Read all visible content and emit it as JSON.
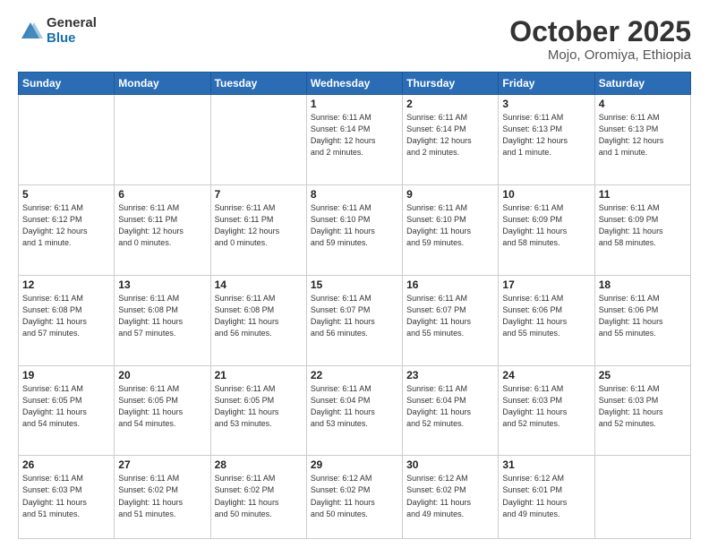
{
  "header": {
    "logo_general": "General",
    "logo_blue": "Blue",
    "title": "October 2025",
    "location": "Mojo, Oromiya, Ethiopia"
  },
  "days_of_week": [
    "Sunday",
    "Monday",
    "Tuesday",
    "Wednesday",
    "Thursday",
    "Friday",
    "Saturday"
  ],
  "weeks": [
    [
      {
        "num": "",
        "info": ""
      },
      {
        "num": "",
        "info": ""
      },
      {
        "num": "",
        "info": ""
      },
      {
        "num": "1",
        "info": "Sunrise: 6:11 AM\nSunset: 6:14 PM\nDaylight: 12 hours\nand 2 minutes."
      },
      {
        "num": "2",
        "info": "Sunrise: 6:11 AM\nSunset: 6:14 PM\nDaylight: 12 hours\nand 2 minutes."
      },
      {
        "num": "3",
        "info": "Sunrise: 6:11 AM\nSunset: 6:13 PM\nDaylight: 12 hours\nand 1 minute."
      },
      {
        "num": "4",
        "info": "Sunrise: 6:11 AM\nSunset: 6:13 PM\nDaylight: 12 hours\nand 1 minute."
      }
    ],
    [
      {
        "num": "5",
        "info": "Sunrise: 6:11 AM\nSunset: 6:12 PM\nDaylight: 12 hours\nand 1 minute."
      },
      {
        "num": "6",
        "info": "Sunrise: 6:11 AM\nSunset: 6:11 PM\nDaylight: 12 hours\nand 0 minutes."
      },
      {
        "num": "7",
        "info": "Sunrise: 6:11 AM\nSunset: 6:11 PM\nDaylight: 12 hours\nand 0 minutes."
      },
      {
        "num": "8",
        "info": "Sunrise: 6:11 AM\nSunset: 6:10 PM\nDaylight: 11 hours\nand 59 minutes."
      },
      {
        "num": "9",
        "info": "Sunrise: 6:11 AM\nSunset: 6:10 PM\nDaylight: 11 hours\nand 59 minutes."
      },
      {
        "num": "10",
        "info": "Sunrise: 6:11 AM\nSunset: 6:09 PM\nDaylight: 11 hours\nand 58 minutes."
      },
      {
        "num": "11",
        "info": "Sunrise: 6:11 AM\nSunset: 6:09 PM\nDaylight: 11 hours\nand 58 minutes."
      }
    ],
    [
      {
        "num": "12",
        "info": "Sunrise: 6:11 AM\nSunset: 6:08 PM\nDaylight: 11 hours\nand 57 minutes."
      },
      {
        "num": "13",
        "info": "Sunrise: 6:11 AM\nSunset: 6:08 PM\nDaylight: 11 hours\nand 57 minutes."
      },
      {
        "num": "14",
        "info": "Sunrise: 6:11 AM\nSunset: 6:08 PM\nDaylight: 11 hours\nand 56 minutes."
      },
      {
        "num": "15",
        "info": "Sunrise: 6:11 AM\nSunset: 6:07 PM\nDaylight: 11 hours\nand 56 minutes."
      },
      {
        "num": "16",
        "info": "Sunrise: 6:11 AM\nSunset: 6:07 PM\nDaylight: 11 hours\nand 55 minutes."
      },
      {
        "num": "17",
        "info": "Sunrise: 6:11 AM\nSunset: 6:06 PM\nDaylight: 11 hours\nand 55 minutes."
      },
      {
        "num": "18",
        "info": "Sunrise: 6:11 AM\nSunset: 6:06 PM\nDaylight: 11 hours\nand 55 minutes."
      }
    ],
    [
      {
        "num": "19",
        "info": "Sunrise: 6:11 AM\nSunset: 6:05 PM\nDaylight: 11 hours\nand 54 minutes."
      },
      {
        "num": "20",
        "info": "Sunrise: 6:11 AM\nSunset: 6:05 PM\nDaylight: 11 hours\nand 54 minutes."
      },
      {
        "num": "21",
        "info": "Sunrise: 6:11 AM\nSunset: 6:05 PM\nDaylight: 11 hours\nand 53 minutes."
      },
      {
        "num": "22",
        "info": "Sunrise: 6:11 AM\nSunset: 6:04 PM\nDaylight: 11 hours\nand 53 minutes."
      },
      {
        "num": "23",
        "info": "Sunrise: 6:11 AM\nSunset: 6:04 PM\nDaylight: 11 hours\nand 52 minutes."
      },
      {
        "num": "24",
        "info": "Sunrise: 6:11 AM\nSunset: 6:03 PM\nDaylight: 11 hours\nand 52 minutes."
      },
      {
        "num": "25",
        "info": "Sunrise: 6:11 AM\nSunset: 6:03 PM\nDaylight: 11 hours\nand 52 minutes."
      }
    ],
    [
      {
        "num": "26",
        "info": "Sunrise: 6:11 AM\nSunset: 6:03 PM\nDaylight: 11 hours\nand 51 minutes."
      },
      {
        "num": "27",
        "info": "Sunrise: 6:11 AM\nSunset: 6:02 PM\nDaylight: 11 hours\nand 51 minutes."
      },
      {
        "num": "28",
        "info": "Sunrise: 6:11 AM\nSunset: 6:02 PM\nDaylight: 11 hours\nand 50 minutes."
      },
      {
        "num": "29",
        "info": "Sunrise: 6:12 AM\nSunset: 6:02 PM\nDaylight: 11 hours\nand 50 minutes."
      },
      {
        "num": "30",
        "info": "Sunrise: 6:12 AM\nSunset: 6:02 PM\nDaylight: 11 hours\nand 49 minutes."
      },
      {
        "num": "31",
        "info": "Sunrise: 6:12 AM\nSunset: 6:01 PM\nDaylight: 11 hours\nand 49 minutes."
      },
      {
        "num": "",
        "info": ""
      }
    ]
  ]
}
